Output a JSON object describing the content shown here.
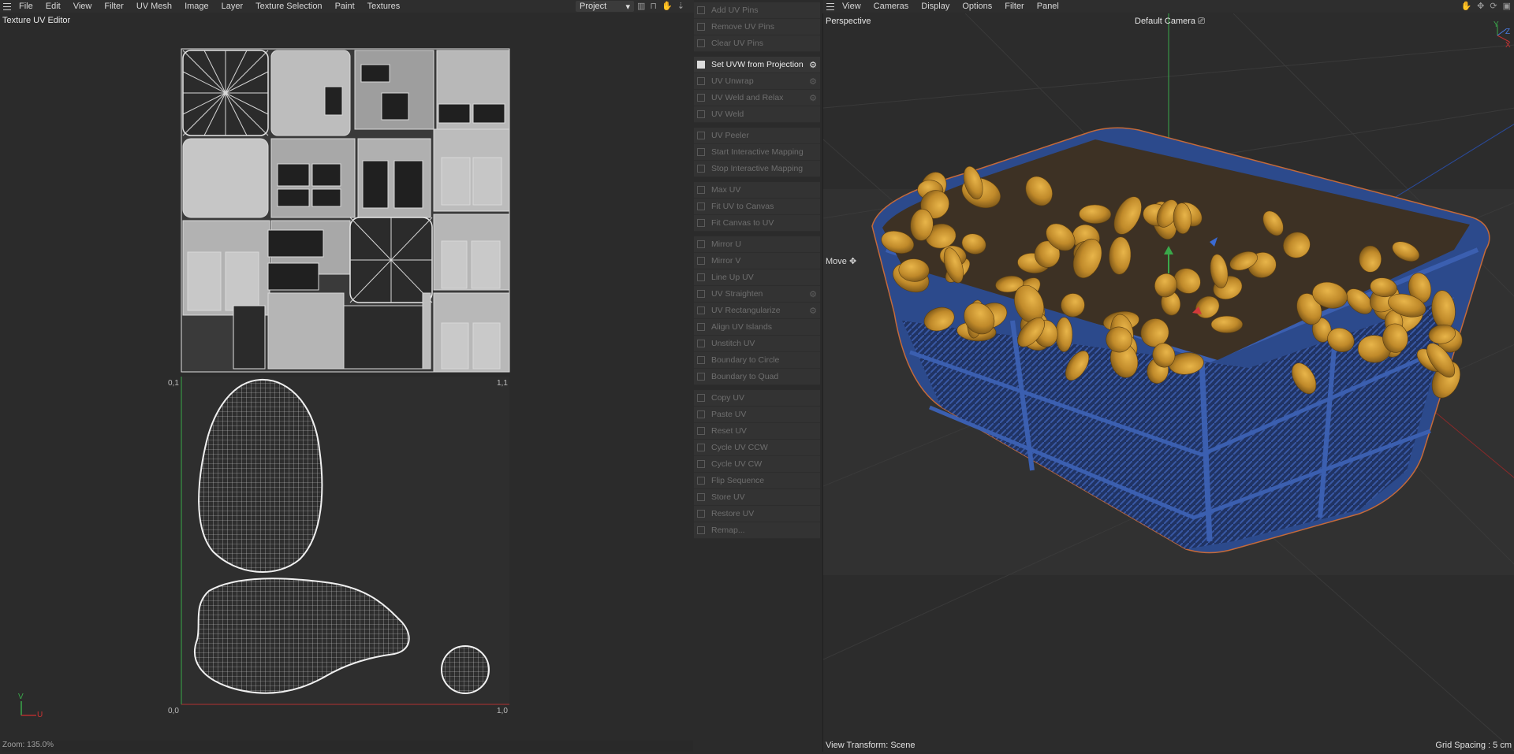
{
  "uv_editor": {
    "menu": [
      "File",
      "Edit",
      "View",
      "Filter",
      "UV Mesh",
      "Image",
      "Layer",
      "Texture Selection",
      "Paint",
      "Textures"
    ],
    "title": "Texture UV Editor",
    "project_dropdown": "Project",
    "coords": {
      "top_left": "0,1",
      "top_right": "1,1",
      "bottom_left": "0,0",
      "bottom_right": "1,0"
    },
    "axis": {
      "v": "V",
      "u": "U"
    },
    "zoom": "Zoom: 135.0%"
  },
  "commands": {
    "groups": [
      [
        {
          "label": "Add UV Pins",
          "gear": false,
          "active": false
        },
        {
          "label": "Remove UV Pins",
          "gear": false,
          "active": false
        },
        {
          "label": "Clear UV Pins",
          "gear": false,
          "active": false
        }
      ],
      [
        {
          "label": "Set UVW from Projection",
          "gear": true,
          "active": true
        },
        {
          "label": "UV Unwrap",
          "gear": true,
          "active": false
        },
        {
          "label": "UV Weld and Relax",
          "gear": true,
          "active": false
        },
        {
          "label": "UV Weld",
          "gear": false,
          "active": false
        }
      ],
      [
        {
          "label": "UV Peeler",
          "gear": false,
          "active": false
        },
        {
          "label": "Start Interactive Mapping",
          "gear": false,
          "active": false
        },
        {
          "label": "Stop Interactive Mapping",
          "gear": false,
          "active": false
        }
      ],
      [
        {
          "label": "Max UV",
          "gear": false,
          "active": false
        },
        {
          "label": "Fit UV to Canvas",
          "gear": false,
          "active": false
        },
        {
          "label": "Fit Canvas to UV",
          "gear": false,
          "active": false
        }
      ],
      [
        {
          "label": "Mirror U",
          "gear": false,
          "active": false
        },
        {
          "label": "Mirror V",
          "gear": false,
          "active": false
        },
        {
          "label": "Line Up UV",
          "gear": false,
          "active": false
        },
        {
          "label": "UV Straighten",
          "gear": true,
          "active": false
        },
        {
          "label": "UV Rectangularize",
          "gear": true,
          "active": false
        },
        {
          "label": "Align UV Islands",
          "gear": false,
          "active": false
        },
        {
          "label": "Unstitch UV",
          "gear": false,
          "active": false
        },
        {
          "label": "Boundary to Circle",
          "gear": false,
          "active": false
        },
        {
          "label": "Boundary to Quad",
          "gear": false,
          "active": false
        }
      ],
      [
        {
          "label": "Copy UV",
          "gear": false,
          "active": false
        },
        {
          "label": "Paste UV",
          "gear": false,
          "active": false
        },
        {
          "label": "Reset UV",
          "gear": false,
          "active": false
        },
        {
          "label": "Cycle UV CCW",
          "gear": false,
          "active": false
        },
        {
          "label": "Cycle UV CW",
          "gear": false,
          "active": false
        },
        {
          "label": "Flip Sequence",
          "gear": false,
          "active": false
        },
        {
          "label": "Store UV",
          "gear": false,
          "active": false
        },
        {
          "label": "Restore UV",
          "gear": false,
          "active": false
        },
        {
          "label": "Remap...",
          "gear": false,
          "active": false
        }
      ]
    ]
  },
  "viewport": {
    "menu": [
      "View",
      "Cameras",
      "Display",
      "Options",
      "Filter",
      "Panel"
    ],
    "label": "Perspective",
    "camera": "Default Camera",
    "tool": "Move",
    "transform": "View Transform: Scene",
    "grid": "Grid Spacing : 5 cm",
    "axis_labels": {
      "x": "X",
      "y": "Y",
      "z": "Z"
    }
  },
  "colors": {
    "basket": "#2c4a8c",
    "potato": "#c9902e",
    "uv_wire": "#d8d8d8",
    "axis_red": "#b23030",
    "axis_green": "#3aa84a"
  }
}
